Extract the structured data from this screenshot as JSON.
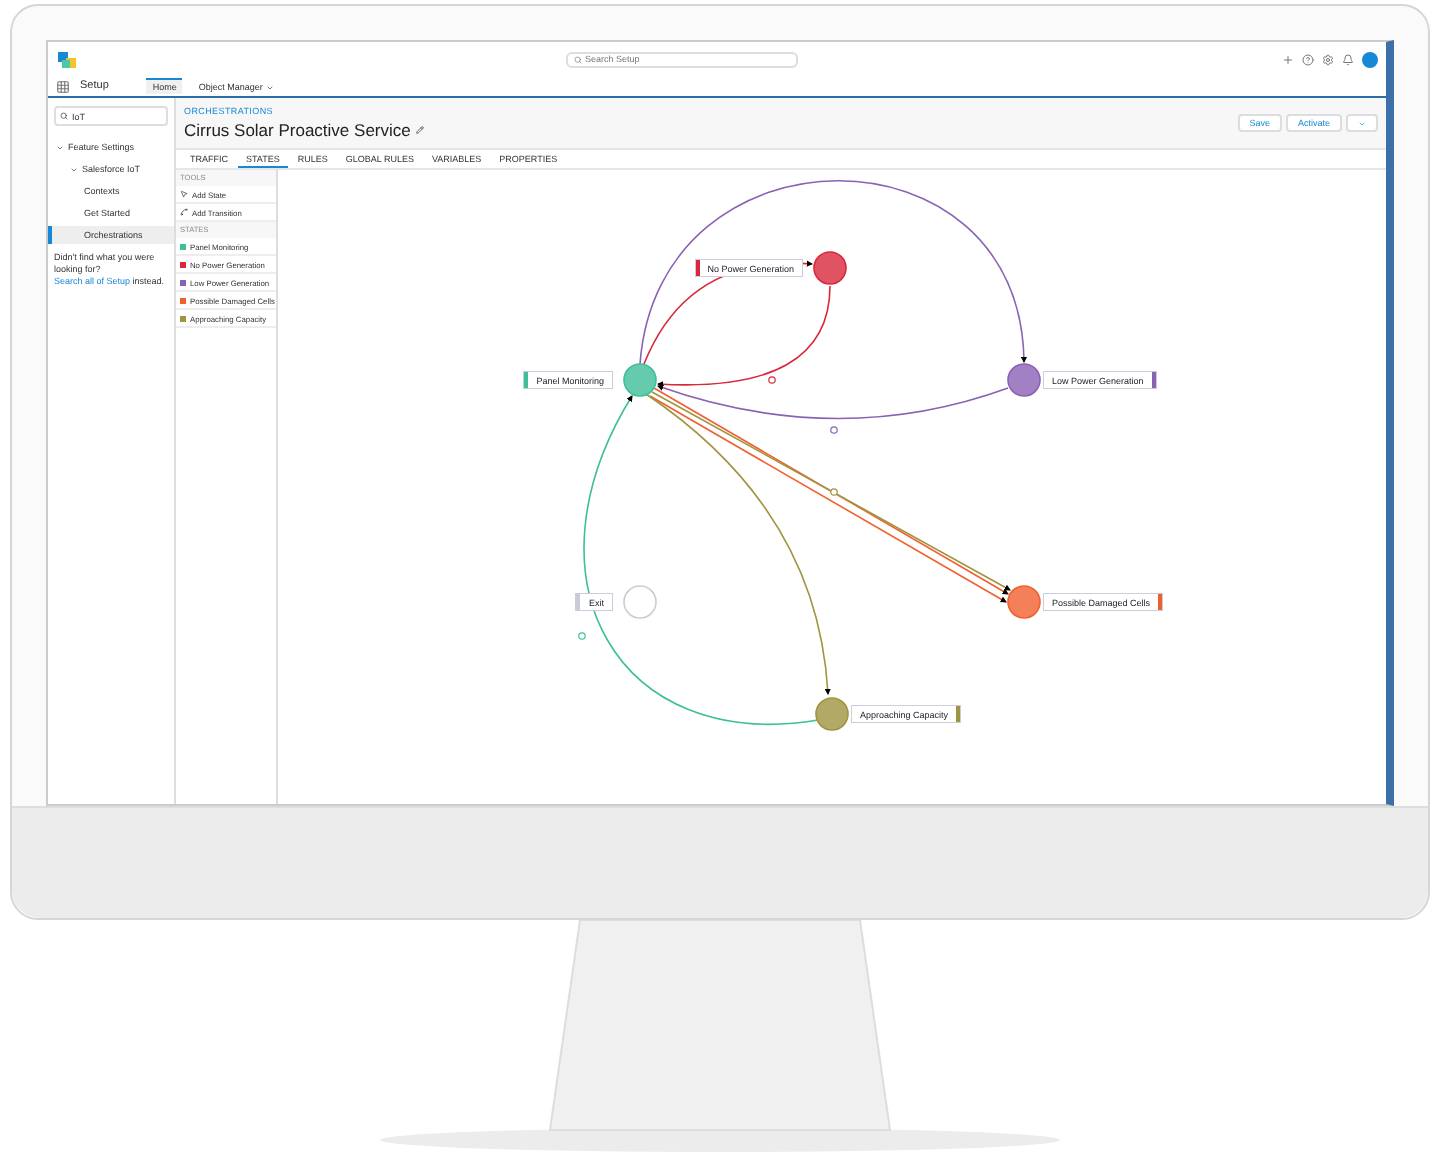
{
  "header": {
    "app_name": "Setup",
    "search": {
      "placeholder": "Search Setup"
    },
    "nav_tabs": [
      {
        "label": "Home",
        "selected": true
      },
      {
        "label": "Object Manager",
        "selected": false
      }
    ]
  },
  "sidebar": {
    "search": {
      "value": "IoT"
    },
    "tree": [
      {
        "label": "Feature Settings",
        "expanded": true,
        "children": [
          {
            "label": "Salesforce IoT",
            "expanded": true,
            "children": [
              {
                "label": "Contexts",
                "selected": false
              },
              {
                "label": "Get Started",
                "selected": false
              },
              {
                "label": "Orchestrations",
                "selected": true
              }
            ]
          }
        ]
      }
    ],
    "help_text": "Didn't find what you were looking for?",
    "help_link": "Search all of Setup",
    "help_suffix": "instead."
  },
  "page": {
    "breadcrumb": "ORCHESTRATIONS",
    "title": "Cirrus Solar Proactive Service",
    "buttons": [
      "Save",
      "Activate"
    ],
    "tabs": [
      {
        "label": "TRAFFIC",
        "selected": false
      },
      {
        "label": "STATES",
        "selected": true
      },
      {
        "label": "RULES",
        "selected": false
      },
      {
        "label": "GLOBAL RULES",
        "selected": false
      },
      {
        "label": "VARIABLES",
        "selected": false
      },
      {
        "label": "PROPERTIES",
        "selected": false
      }
    ]
  },
  "tools": {
    "heading": "TOOLS",
    "items": [
      {
        "label": "Add State",
        "kind": "state"
      },
      {
        "label": "Add Transition",
        "kind": "transition"
      }
    ]
  },
  "states": {
    "heading": "STATES",
    "items": [
      {
        "name": "Panel Monitoring",
        "color": "#3dbf98"
      },
      {
        "name": "No Power Generation",
        "color": "#d8283c"
      },
      {
        "name": "Low Power Generation",
        "color": "#8a62b5"
      },
      {
        "name": "Possible Damaged Cells",
        "color": "#f0602e"
      },
      {
        "name": "Approaching Capacity",
        "color": "#a09440"
      }
    ]
  },
  "diagram": {
    "nodes": [
      {
        "label": "Panel Monitoring",
        "kind": "state",
        "color": "#3dbf98"
      },
      {
        "label": "No Power Generation",
        "kind": "state",
        "color": "#d8283c"
      },
      {
        "label": "Low Power Generation",
        "kind": "state",
        "color": "#8a62b5"
      },
      {
        "label": "Possible Damaged Cells",
        "kind": "state",
        "color": "#f0602e"
      },
      {
        "label": "Approaching Capacity",
        "kind": "state",
        "color": "#a09440"
      },
      {
        "label": "Exit",
        "kind": "exit",
        "color": "#c8ccd4"
      }
    ]
  }
}
